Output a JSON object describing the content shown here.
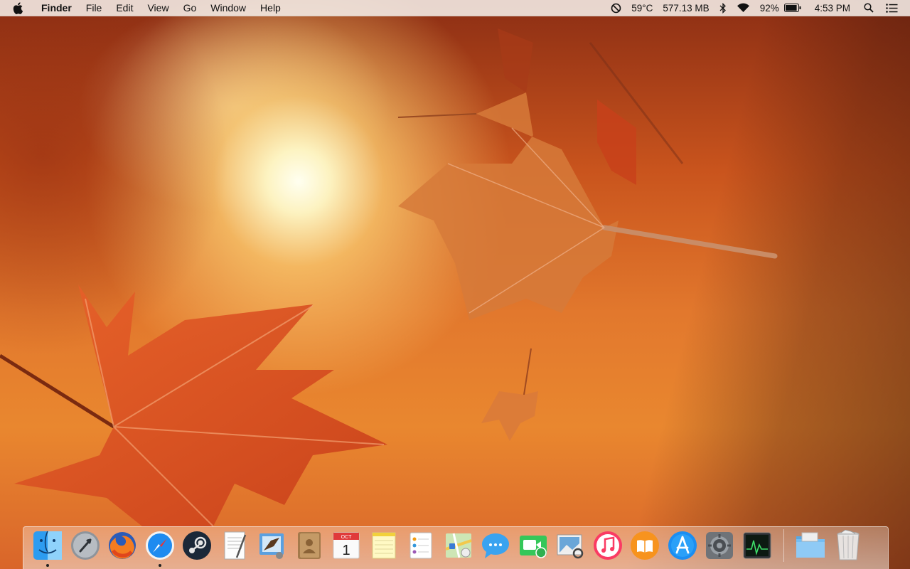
{
  "menubar": {
    "app_name": "Finder",
    "menus": [
      "File",
      "Edit",
      "View",
      "Go",
      "Window",
      "Help"
    ],
    "status": {
      "temperature": "59°C",
      "memory": "577.13 MB",
      "battery_percent": "92%",
      "battery_level": 0.92,
      "time": "4:53 PM"
    }
  },
  "dock": {
    "apps": [
      {
        "name": "Finder",
        "icon": "finder-icon",
        "running": true
      },
      {
        "name": "Launchpad",
        "icon": "launchpad-icon",
        "running": false
      },
      {
        "name": "Firefox",
        "icon": "firefox-icon",
        "running": false
      },
      {
        "name": "Safari",
        "icon": "safari-icon",
        "running": true
      },
      {
        "name": "Steam",
        "icon": "steam-icon",
        "running": false
      },
      {
        "name": "TextEdit",
        "icon": "textedit-icon",
        "running": false
      },
      {
        "name": "Mail",
        "icon": "mail-icon",
        "running": false
      },
      {
        "name": "Contacts",
        "icon": "contacts-icon",
        "running": false
      },
      {
        "name": "Calendar",
        "icon": "calendar-icon",
        "running": false,
        "month": "OCT",
        "day": "1"
      },
      {
        "name": "Notes",
        "icon": "notes-icon",
        "running": false
      },
      {
        "name": "Reminders",
        "icon": "reminders-icon",
        "running": false
      },
      {
        "name": "Maps",
        "icon": "maps-icon",
        "running": false
      },
      {
        "name": "Messages",
        "icon": "messages-icon",
        "running": false
      },
      {
        "name": "FaceTime",
        "icon": "facetime-icon",
        "running": false
      },
      {
        "name": "Preview",
        "icon": "preview-icon",
        "running": false
      },
      {
        "name": "iTunes",
        "icon": "itunes-icon",
        "running": false
      },
      {
        "name": "iBooks",
        "icon": "ibooks-icon",
        "running": false
      },
      {
        "name": "App Store",
        "icon": "app-store-icon",
        "running": false
      },
      {
        "name": "System Preferences",
        "icon": "system-preferences-icon",
        "running": false
      },
      {
        "name": "Activity Monitor",
        "icon": "activity-monitor-icon",
        "running": false
      }
    ],
    "stacks": [
      {
        "name": "Downloads",
        "icon": "folder-icon"
      },
      {
        "name": "Trash",
        "icon": "trash-icon"
      }
    ]
  }
}
